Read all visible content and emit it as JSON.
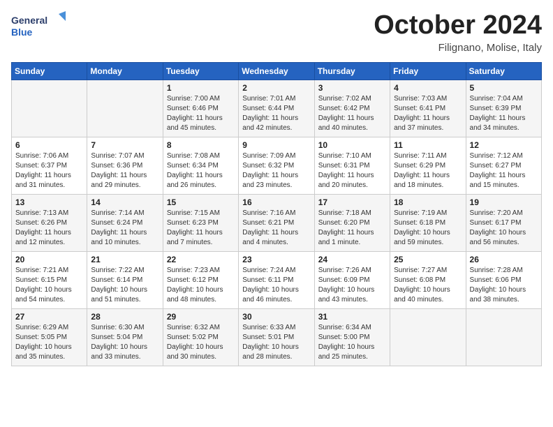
{
  "logo": {
    "line1": "General",
    "line2": "Blue"
  },
  "title": "October 2024",
  "location": "Filignano, Molise, Italy",
  "days_of_week": [
    "Sunday",
    "Monday",
    "Tuesday",
    "Wednesday",
    "Thursday",
    "Friday",
    "Saturday"
  ],
  "weeks": [
    [
      {
        "day": "",
        "detail": ""
      },
      {
        "day": "",
        "detail": ""
      },
      {
        "day": "1",
        "detail": "Sunrise: 7:00 AM\nSunset: 6:46 PM\nDaylight: 11 hours and 45 minutes."
      },
      {
        "day": "2",
        "detail": "Sunrise: 7:01 AM\nSunset: 6:44 PM\nDaylight: 11 hours and 42 minutes."
      },
      {
        "day": "3",
        "detail": "Sunrise: 7:02 AM\nSunset: 6:42 PM\nDaylight: 11 hours and 40 minutes."
      },
      {
        "day": "4",
        "detail": "Sunrise: 7:03 AM\nSunset: 6:41 PM\nDaylight: 11 hours and 37 minutes."
      },
      {
        "day": "5",
        "detail": "Sunrise: 7:04 AM\nSunset: 6:39 PM\nDaylight: 11 hours and 34 minutes."
      }
    ],
    [
      {
        "day": "6",
        "detail": "Sunrise: 7:06 AM\nSunset: 6:37 PM\nDaylight: 11 hours and 31 minutes."
      },
      {
        "day": "7",
        "detail": "Sunrise: 7:07 AM\nSunset: 6:36 PM\nDaylight: 11 hours and 29 minutes."
      },
      {
        "day": "8",
        "detail": "Sunrise: 7:08 AM\nSunset: 6:34 PM\nDaylight: 11 hours and 26 minutes."
      },
      {
        "day": "9",
        "detail": "Sunrise: 7:09 AM\nSunset: 6:32 PM\nDaylight: 11 hours and 23 minutes."
      },
      {
        "day": "10",
        "detail": "Sunrise: 7:10 AM\nSunset: 6:31 PM\nDaylight: 11 hours and 20 minutes."
      },
      {
        "day": "11",
        "detail": "Sunrise: 7:11 AM\nSunset: 6:29 PM\nDaylight: 11 hours and 18 minutes."
      },
      {
        "day": "12",
        "detail": "Sunrise: 7:12 AM\nSunset: 6:27 PM\nDaylight: 11 hours and 15 minutes."
      }
    ],
    [
      {
        "day": "13",
        "detail": "Sunrise: 7:13 AM\nSunset: 6:26 PM\nDaylight: 11 hours and 12 minutes."
      },
      {
        "day": "14",
        "detail": "Sunrise: 7:14 AM\nSunset: 6:24 PM\nDaylight: 11 hours and 10 minutes."
      },
      {
        "day": "15",
        "detail": "Sunrise: 7:15 AM\nSunset: 6:23 PM\nDaylight: 11 hours and 7 minutes."
      },
      {
        "day": "16",
        "detail": "Sunrise: 7:16 AM\nSunset: 6:21 PM\nDaylight: 11 hours and 4 minutes."
      },
      {
        "day": "17",
        "detail": "Sunrise: 7:18 AM\nSunset: 6:20 PM\nDaylight: 11 hours and 1 minute."
      },
      {
        "day": "18",
        "detail": "Sunrise: 7:19 AM\nSunset: 6:18 PM\nDaylight: 10 hours and 59 minutes."
      },
      {
        "day": "19",
        "detail": "Sunrise: 7:20 AM\nSunset: 6:17 PM\nDaylight: 10 hours and 56 minutes."
      }
    ],
    [
      {
        "day": "20",
        "detail": "Sunrise: 7:21 AM\nSunset: 6:15 PM\nDaylight: 10 hours and 54 minutes."
      },
      {
        "day": "21",
        "detail": "Sunrise: 7:22 AM\nSunset: 6:14 PM\nDaylight: 10 hours and 51 minutes."
      },
      {
        "day": "22",
        "detail": "Sunrise: 7:23 AM\nSunset: 6:12 PM\nDaylight: 10 hours and 48 minutes."
      },
      {
        "day": "23",
        "detail": "Sunrise: 7:24 AM\nSunset: 6:11 PM\nDaylight: 10 hours and 46 minutes."
      },
      {
        "day": "24",
        "detail": "Sunrise: 7:26 AM\nSunset: 6:09 PM\nDaylight: 10 hours and 43 minutes."
      },
      {
        "day": "25",
        "detail": "Sunrise: 7:27 AM\nSunset: 6:08 PM\nDaylight: 10 hours and 40 minutes."
      },
      {
        "day": "26",
        "detail": "Sunrise: 7:28 AM\nSunset: 6:06 PM\nDaylight: 10 hours and 38 minutes."
      }
    ],
    [
      {
        "day": "27",
        "detail": "Sunrise: 6:29 AM\nSunset: 5:05 PM\nDaylight: 10 hours and 35 minutes."
      },
      {
        "day": "28",
        "detail": "Sunrise: 6:30 AM\nSunset: 5:04 PM\nDaylight: 10 hours and 33 minutes."
      },
      {
        "day": "29",
        "detail": "Sunrise: 6:32 AM\nSunset: 5:02 PM\nDaylight: 10 hours and 30 minutes."
      },
      {
        "day": "30",
        "detail": "Sunrise: 6:33 AM\nSunset: 5:01 PM\nDaylight: 10 hours and 28 minutes."
      },
      {
        "day": "31",
        "detail": "Sunrise: 6:34 AM\nSunset: 5:00 PM\nDaylight: 10 hours and 25 minutes."
      },
      {
        "day": "",
        "detail": ""
      },
      {
        "day": "",
        "detail": ""
      }
    ]
  ]
}
